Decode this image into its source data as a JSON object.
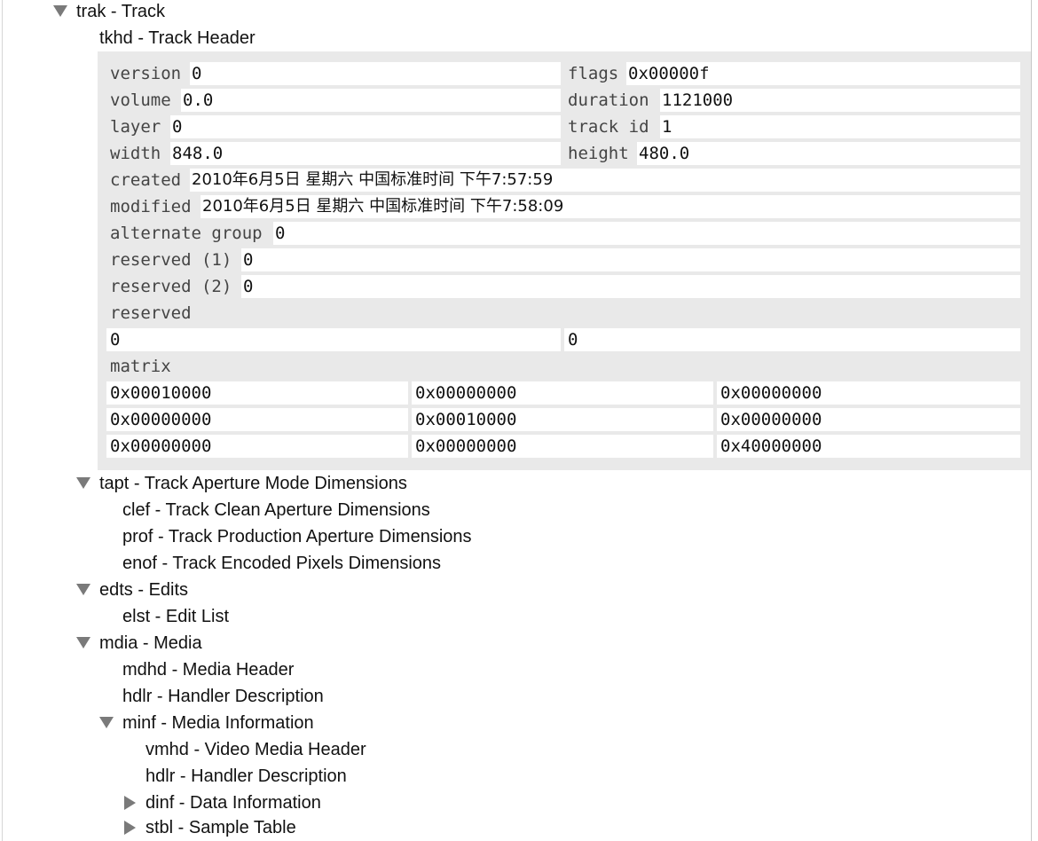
{
  "tree": {
    "trak": "trak - Track",
    "tkhd": "tkhd - Track Header",
    "tapt": "tapt - Track Aperture Mode Dimensions",
    "clef": "clef - Track Clean Aperture Dimensions",
    "prof": "prof - Track Production Aperture Dimensions",
    "enof": "enof - Track Encoded Pixels Dimensions",
    "edts": "edts - Edits",
    "elst": "elst - Edit List",
    "mdia": "mdia - Media",
    "mdhd": "mdhd - Media Header",
    "hdlr": "hdlr - Handler Description",
    "minf": "minf - Media Information",
    "vmhd": "vmhd - Video Media Header",
    "hdlr2": "hdlr - Handler Description",
    "dinf": "dinf - Data Information",
    "stbl": "stbl - Sample Table"
  },
  "tkhd": {
    "version_key": "version",
    "version": "0",
    "flags_key": "flags",
    "flags": "0x00000f",
    "volume_key": "volume",
    "volume": "0.0",
    "duration_key": "duration",
    "duration": "1121000",
    "layer_key": "layer",
    "layer": "0",
    "track_id_key": "track id",
    "track_id": "1",
    "width_key": "width",
    "width": "848.0",
    "height_key": "height",
    "height": "480.0",
    "created_key": "created",
    "created": "2010年6月5日 星期六 中国标准时间 下午7:57:59",
    "modified_key": "modified",
    "modified": "2010年6月5日 星期六 中国标准时间 下午7:58:09",
    "alternate_group_key": "alternate group",
    "alternate_group": "0",
    "reserved1_key": "reserved (1)",
    "reserved1": "0",
    "reserved2_key": "reserved (2)",
    "reserved2": "0",
    "reserved_key": "reserved",
    "reserved": [
      "0",
      "0"
    ],
    "matrix_key": "matrix",
    "matrix": [
      [
        "0x00010000",
        "0x00000000",
        "0x00000000"
      ],
      [
        "0x00000000",
        "0x00010000",
        "0x00000000"
      ],
      [
        "0x00000000",
        "0x00000000",
        "0x40000000"
      ]
    ]
  },
  "colors": {
    "panel_bg": "#e9e9e9",
    "cell_bg": "#ffffff",
    "triangle": "#7a7a7a"
  }
}
